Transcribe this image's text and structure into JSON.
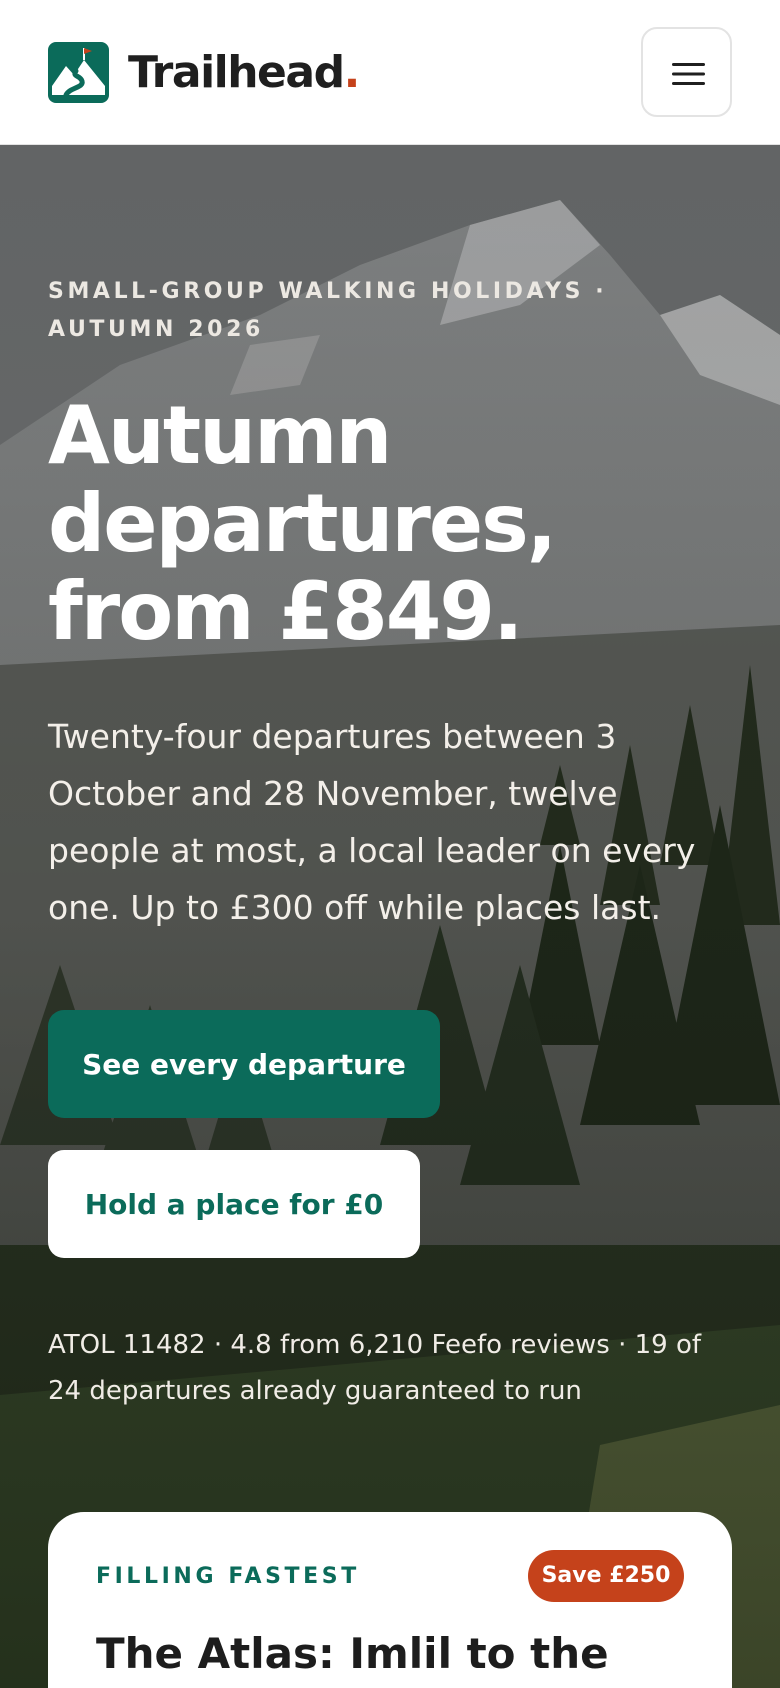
{
  "header": {
    "brand_name": "Trailhead",
    "brand_dot": ".",
    "logo_icon": "mountain-flag-logo",
    "menu_icon": "hamburger-menu-icon"
  },
  "hero": {
    "eyebrow": "Small-group walking holidays · Autumn 2026",
    "headline": "Autumn departures, from £849.",
    "lede": "Twenty-four departures between 3 October and 28 November, twelve people at most, a local leader on every one. Up to £300 off while places last.",
    "primary_cta": "See every departure",
    "secondary_cta": "Hold a place for £0",
    "trust_line": "ATOL 11482 · 4.8 from 6,210 Feefo reviews · 19 of 24 departures already guaranteed to run"
  },
  "card": {
    "eyebrow": "FILLING FASTEST",
    "badge": "Save £250",
    "title": "The Atlas: Imlil to the"
  },
  "colors": {
    "brand_green": "#0b6b5a",
    "accent_orange": "#c5421b",
    "ink": "#1f1f1f"
  }
}
